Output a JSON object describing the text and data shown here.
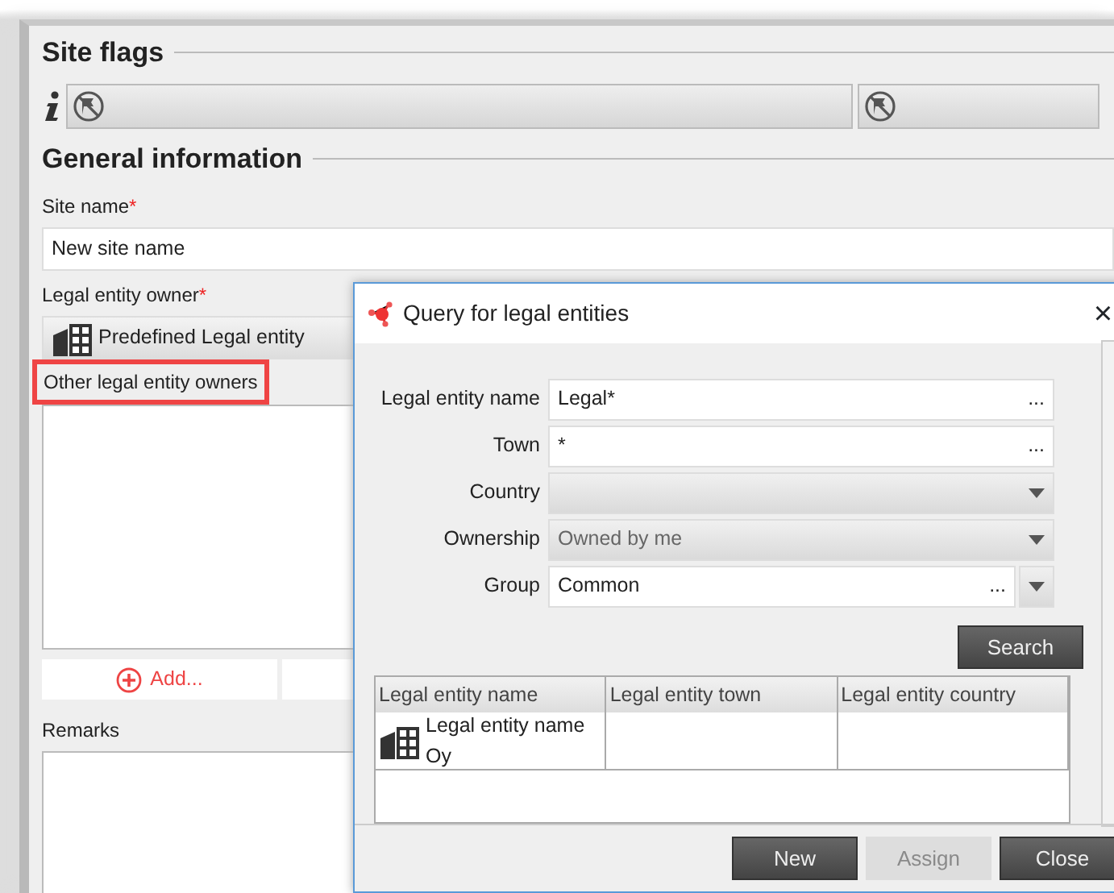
{
  "site_flags": {
    "title": "Site flags"
  },
  "general_information": {
    "title": "General information",
    "site_name": {
      "label": "Site name",
      "required": true,
      "value": "New site name"
    },
    "legal_entity_owner": {
      "label": "Legal entity owner",
      "required": true,
      "value": "Predefined Legal entity"
    },
    "other_owners": {
      "label": "Other legal entity owners",
      "highlighted": true,
      "buttons": [
        {
          "label": "Add...",
          "kind": "add"
        },
        {
          "kind": "blank"
        }
      ]
    },
    "remarks": {
      "label": "Remarks"
    }
  },
  "dialog": {
    "title": "Query for legal entities",
    "close": "×",
    "fields": [
      {
        "label": "Legal entity name",
        "kind": "text",
        "value": "Legal*",
        "ellipsis": "..."
      },
      {
        "label": "Town",
        "kind": "text",
        "value": "*",
        "ellipsis": "..."
      },
      {
        "label": "Country",
        "kind": "select"
      },
      {
        "label": "Ownership",
        "kind": "select",
        "value": "Owned by me"
      },
      {
        "label": "Group",
        "kind": "combo",
        "value": "Common",
        "ellipsis": "..."
      }
    ],
    "search_button": "Search",
    "table": {
      "columns": [
        "Legal entity name",
        "Legal entity town",
        "Legal entity country"
      ],
      "rows": [
        [
          "Legal entity name Oy",
          "",
          ""
        ]
      ]
    },
    "buttons": [
      {
        "label": "New",
        "disabled": false
      },
      {
        "label": "Assign",
        "disabled": true
      },
      {
        "label": "Close",
        "disabled": false
      }
    ]
  }
}
